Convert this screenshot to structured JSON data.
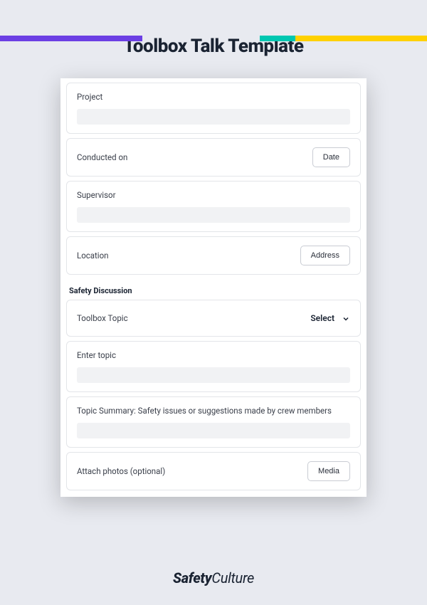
{
  "title": "Toolbox Talk Template",
  "fields": {
    "project": {
      "label": "Project"
    },
    "conducted_on": {
      "label": "Conducted on",
      "button": "Date"
    },
    "supervisor": {
      "label": "Supervisor"
    },
    "location": {
      "label": "Location",
      "button": "Address"
    },
    "section_heading": "Safety Discussion",
    "toolbox_topic": {
      "label": "Toolbox Topic",
      "select": "Select"
    },
    "enter_topic": {
      "label": "Enter topic"
    },
    "topic_summary": {
      "label": "Topic Summary: Safety issues or suggestions made by crew members"
    },
    "attach_photos": {
      "label": "Attach photos (optional)",
      "button": "Media"
    }
  },
  "brand": {
    "first": "Safety",
    "second": "Culture"
  }
}
